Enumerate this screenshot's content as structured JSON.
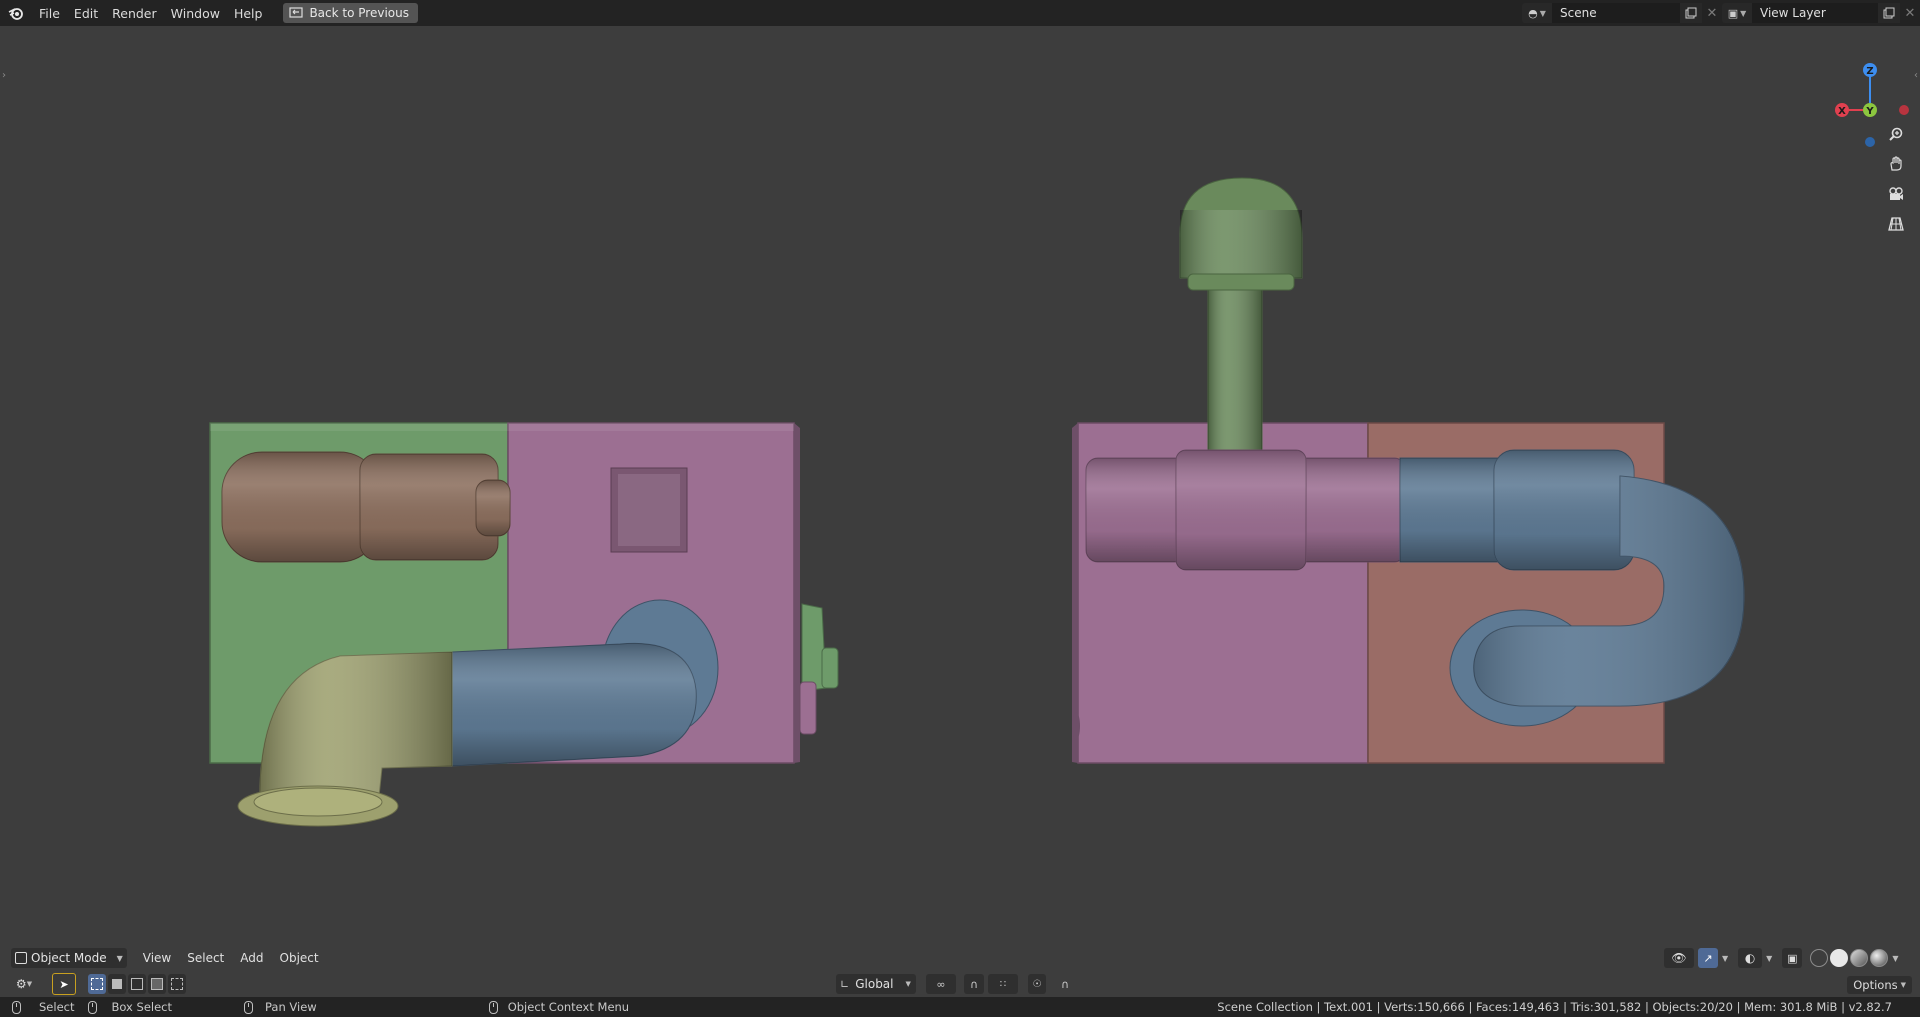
{
  "topbar": {
    "menus": [
      "File",
      "Edit",
      "Render",
      "Window",
      "Help"
    ],
    "back_button": "Back to Previous",
    "scene_name": "Scene",
    "view_layer_name": "View Layer"
  },
  "viewport": {
    "gizmo_axes": {
      "z": "Z",
      "y": "Y",
      "x": "X"
    },
    "nav_icons": [
      "zoom-icon",
      "pan-hand-icon",
      "camera-icon",
      "perspective-grid-icon"
    ]
  },
  "header": {
    "mode": "Object Mode",
    "menus": [
      "View",
      "Select",
      "Add",
      "Object"
    ]
  },
  "toolbar": {
    "transform_orientation": "Global",
    "options_label": "Options"
  },
  "statusbar": {
    "select": "Select",
    "box_select": "Box Select",
    "pan_view": "Pan View",
    "context_menu": "Object Context Menu",
    "stats": "Scene Collection | Text.001 | Verts:150,666 | Faces:149,463 | Tris:301,582 | Objects:20/20 | Mem: 301.8 MiB | v2.82.7"
  },
  "colors": {
    "green": "#6e9b6a",
    "pink": "#9c6f92",
    "blue": "#5e7a94",
    "brown": "#8c6f5e",
    "olive": "#9da06e",
    "terracotta": "#9a6c66",
    "axis_x": "#e0404f",
    "axis_y": "#8cc63f",
    "axis_z": "#3d8ef0"
  }
}
